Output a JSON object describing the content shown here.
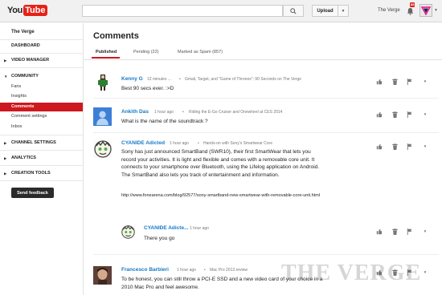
{
  "header": {
    "logo_you": "You",
    "logo_tube": "Tube",
    "upload_label": "Upload",
    "username": "The Verge",
    "notification_count": "88"
  },
  "sidebar": {
    "channel_name": "The Verge",
    "dashboard": "DASHBOARD",
    "video_manager": "VIDEO MANAGER",
    "community": "COMMUNITY",
    "fans": "Fans",
    "insights": "Insights",
    "comments": "Comments",
    "comment_settings": "Comment settings",
    "inbox": "Inbox",
    "channel_settings": "CHANNEL SETTINGS",
    "analytics": "ANALYTICS",
    "creation_tools": "CREATION TOOLS",
    "send_feedback": "Send feedback"
  },
  "main": {
    "title": "Comments",
    "tabs": [
      {
        "label": "Published"
      },
      {
        "label": "Pending (22)"
      },
      {
        "label": "Marked as Spam (857)"
      }
    ],
    "comments": [
      {
        "author": "Kenny G",
        "time": "12 minutes ...",
        "video": "Gmail, Target, and \"Game of Thrones\": 90 Seconds on The Verge",
        "text": "Best 90 secs ever. :>D"
      },
      {
        "author": "Ankith Das",
        "time": "1 hour ago",
        "video": "Riding the E-Go Cruiser and Onewheel at CES 2014",
        "text": "What is the name of the soundtrack ?"
      },
      {
        "author": "CYANIDE Adicted",
        "time": "1 hour ago",
        "video": "Hands-on with Sony's Smartwear Core",
        "text": "Sony has just announced SmartBand (SWR10), their first SmartWear that lets you record your activities. It is light and flexible and comes with a removable core unit. It connects to your smartphone over Bluetooth, using the Lifelog application on Android. The SmartBand also lets you track of entertainment and information.",
        "link": "http://www.fonearena.com/blog/92577/sony-smartband-new-smartwear-with-removable-core-unit.html"
      },
      {
        "author": "Francesco Barbieri",
        "time": "1 hour ago",
        "video": "Mac Pro 2013 review",
        "text": "To be honest, you can still throw a PCI-E SSD and a new video card of your choice in a 2010 Mac Pro and feel awesome."
      }
    ],
    "reply": {
      "author": "CYANIDE Adicte...",
      "time": "1 hour ago",
      "text": "There you go"
    }
  },
  "watermark": "THE VERGE",
  "colors": {
    "accent": "#cc181e",
    "link": "#167ac6"
  }
}
